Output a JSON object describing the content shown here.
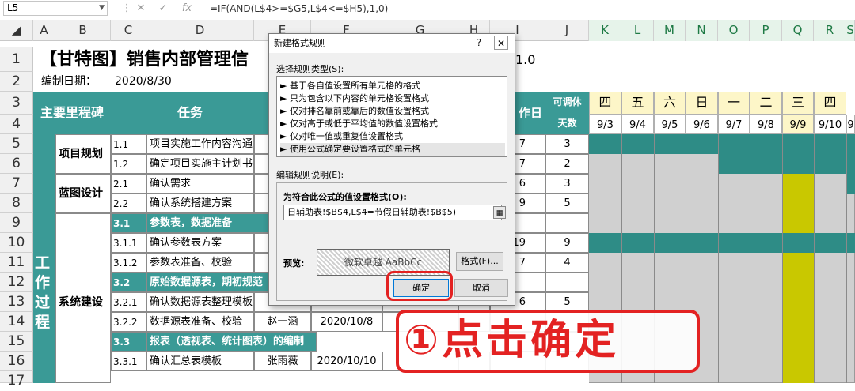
{
  "formula_bar": {
    "name_box": "L5",
    "formula": "=IF(AND(L$4>=$G5,L$4<=$H5),1,0)",
    "cancel": "✕",
    "enter": "✓",
    "fx": "fx"
  },
  "columns": [
    "A",
    "B",
    "C",
    "D",
    "E",
    "F",
    "G",
    "H",
    "I",
    "J",
    "K",
    "L",
    "M",
    "N",
    "O",
    "P",
    "Q",
    "R",
    "S"
  ],
  "rows": [
    "1",
    "2",
    "3",
    "4",
    "5",
    "6",
    "7",
    "8",
    "9",
    "10",
    "11",
    "12",
    "13",
    "14",
    "15",
    "16"
  ],
  "sheet": {
    "title": "【甘特图】销售内部管理信",
    "version": "1.0",
    "date_label": "编制日期：",
    "date_value": "2020/8/30",
    "hdr_milestone": "主要里程碑",
    "hdr_task": "任务",
    "hdr_workday": "作日",
    "hdr_rest1": "可调休",
    "hdr_rest2": "天数",
    "weekdays": [
      "四",
      "五",
      "六",
      "日",
      "一",
      "二",
      "三",
      "四"
    ],
    "dates": [
      "9/3",
      "9/4",
      "9/5",
      "9/6",
      "9/7",
      "9/8",
      "9/9",
      "9/10",
      "9"
    ],
    "big_milestone": [
      "工",
      "作",
      "过",
      "程"
    ],
    "milestones": [
      "项目规划",
      "蓝图设计",
      "系统建设"
    ],
    "tasks": [
      {
        "id": "1.1",
        "name": "项目实施工作内容沟通",
        "j": "7",
        "k": "3"
      },
      {
        "id": "1.2",
        "name": "确定项目实施主计划书",
        "j": "7",
        "k": "2"
      },
      {
        "id": "2.1",
        "name": "确认需求",
        "j": "6",
        "k": "3"
      },
      {
        "id": "2.2",
        "name": "确认系统搭建方案",
        "j": "9",
        "k": "5"
      },
      {
        "id": "3.1",
        "name": "参数表，数据准备",
        "j": "",
        "k": ""
      },
      {
        "id": "3.1.1",
        "name": "确认参数表方案",
        "j": "19",
        "k": "9"
      },
      {
        "id": "3.1.2",
        "name": "参数表准备、校验",
        "j": "7",
        "k": "4"
      },
      {
        "id": "3.2",
        "name": "原始数据源表，期初规范",
        "j": "",
        "k": ""
      },
      {
        "id": "3.2.1",
        "name": "确认数据源表整理模板",
        "j": "6",
        "k": "5"
      },
      {
        "id": "3.2.2",
        "name": "数据源表准备、校验",
        "f": "赵一涵",
        "g": "2020/10/8",
        "j": "",
        "k": ""
      },
      {
        "id": "3.3",
        "name": "报表（透视表、统计图表）的编制",
        "j": "",
        "k": ""
      },
      {
        "id": "3.3.1",
        "name": "确认汇总表模板",
        "f": "张雨薇",
        "g": "2020/10/10",
        "j": "",
        "k": ""
      }
    ]
  },
  "dialog": {
    "title": "新建格式规则",
    "help": "?",
    "close": "✕",
    "select_type_label": "选择规则类型(S):",
    "rule_types": [
      "► 基于各自值设置所有单元格的格式",
      "► 只为包含以下内容的单元格设置格式",
      "► 仅对排名靠前或靠后的数值设置格式",
      "► 仅对高于或低于平均值的数值设置格式",
      "► 仅对唯一值或重复值设置格式",
      "► 使用公式确定要设置格式的单元格"
    ],
    "edit_label": "编辑规则说明(E):",
    "formula_label": "为符合此公式的值设置格式(O):",
    "formula_value": "日辅助表!$B$4,L$4=节假日辅助表!$B$5)",
    "preview_label": "预览:",
    "preview_text": "微软卓越  AaBbCc",
    "format_button": "格式(F)...",
    "ok_button": "确定",
    "cancel_button": "取消"
  },
  "annotation": {
    "text": "①点击确定"
  },
  "colors": {
    "teal": "#3a9a96",
    "yellow": "#c9c800",
    "red": "#e32222"
  }
}
